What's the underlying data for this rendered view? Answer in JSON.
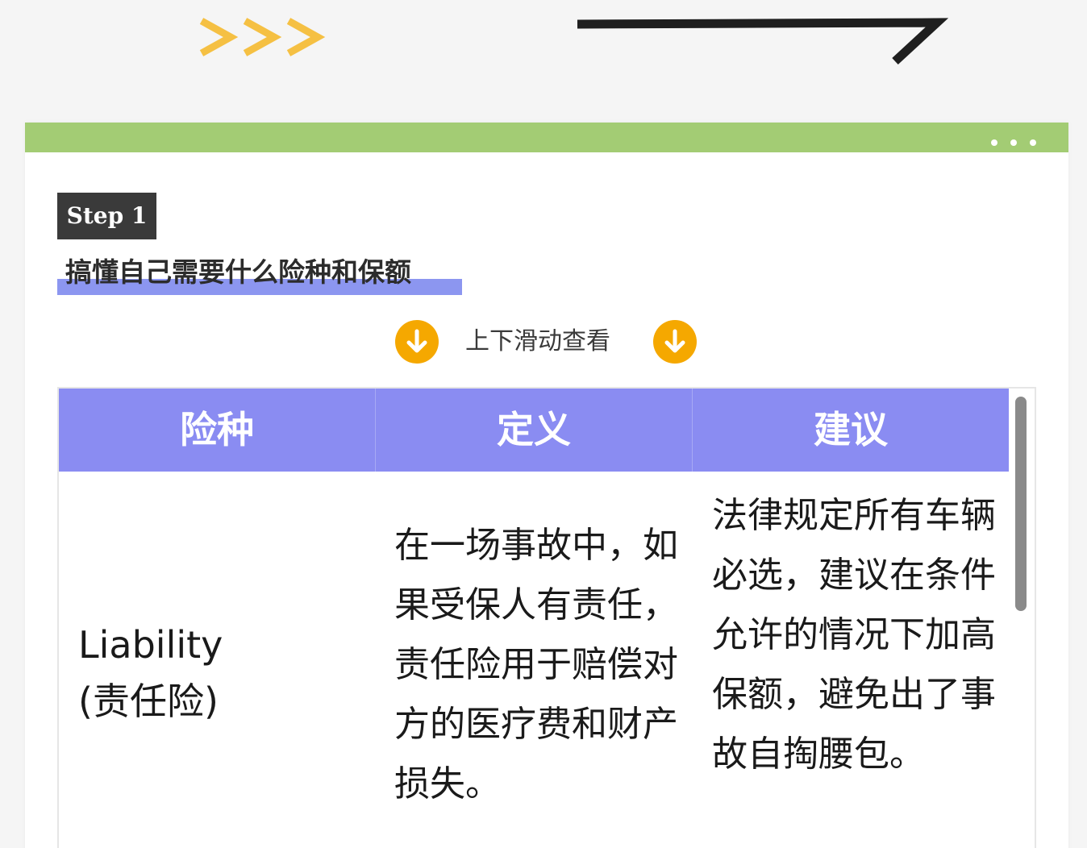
{
  "decoration": {
    "chevrons_icon": "triple-chevron-right-icon",
    "chevron_color": "#f5c043",
    "hook_icon": "hook-line-icon"
  },
  "card": {
    "bar_color": "#a3cc74",
    "menu_icon": "more-dots-icon"
  },
  "step": {
    "label": "Step 1"
  },
  "section": {
    "title": "搞懂自己需要什么险种和保额",
    "underline_color": "#8c96f0"
  },
  "scroll_hint": {
    "text": "上下滑动查看",
    "icon": "arrow-down-circle-icon",
    "icon_color": "#f5a800"
  },
  "table": {
    "header_color": "#8a8cf2",
    "headers": [
      "险种",
      "定义",
      "建议"
    ],
    "rows": [
      {
        "type": "Liability\n(责任险)",
        "definition": "在一场事故中，如果受保人有责任，责任险用于赔偿对方的医疗费和财产损失。",
        "advice": "法律规定所有车辆必选，建议在条件允许的情况下加高保额，避免出了事故自掏腰包。"
      }
    ]
  }
}
